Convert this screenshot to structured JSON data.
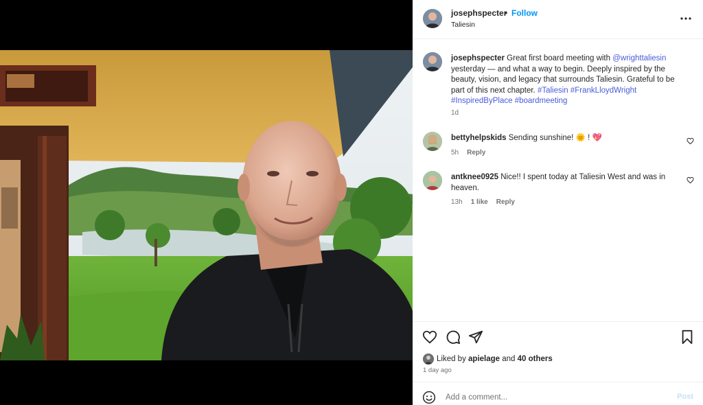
{
  "post": {
    "author": "josephspecter",
    "follow_label": "Follow",
    "separator": "•",
    "location": "Taliesin"
  },
  "caption": {
    "username": "josephspecter",
    "text_1": " Great first board meeting with ",
    "mention": "@wrighttaliesin",
    "text_2": " yesterday — and what a way to begin. Deeply inspired by the beauty, vision, and legacy that surrounds Taliesin. Grateful to be part of this next chapter. ",
    "hashtags": [
      "#Taliesin",
      "#FrankLloydWright",
      "#InspiredByPlace",
      "#boardmeeting"
    ],
    "age": "1d"
  },
  "comments": [
    {
      "username": "bettyhelpskids",
      "text": " Sending sunshine! 🌞 ! 💖",
      "age": "5h",
      "likes": "",
      "reply_label": "Reply"
    },
    {
      "username": "antknee0925",
      "text": " Nice!! I spent today at Taliesin West and was in heaven.",
      "age": "13h",
      "likes": "1 like",
      "reply_label": "Reply"
    }
  ],
  "likes": {
    "prefix": "Liked by ",
    "first_liker": "apielage",
    "conjunction": " and ",
    "others": "40 others"
  },
  "date": "1 day ago",
  "add_comment": {
    "placeholder": "Add a comment...",
    "post_label": "Post"
  },
  "icons": {
    "more": "more-options-icon",
    "like": "heart-icon",
    "comment": "comment-icon",
    "share": "share-icon",
    "save": "bookmark-icon",
    "emoji": "emoji-icon"
  },
  "colors": {
    "link": "#4a5bd6",
    "follow": "#0095f6",
    "muted": "#737373",
    "post_disabled": "#c7e0f4"
  }
}
